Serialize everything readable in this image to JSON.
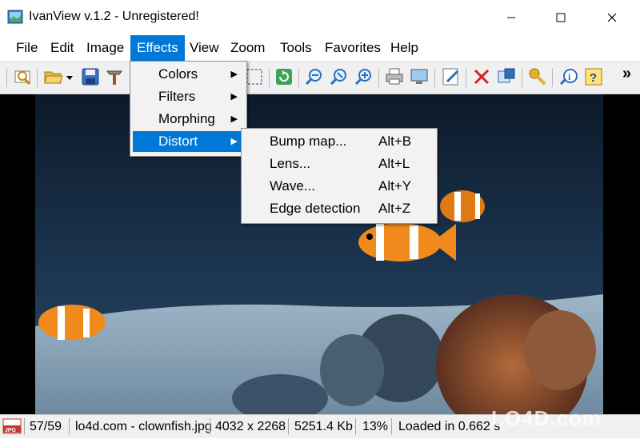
{
  "window": {
    "title": "IvanView v.1.2 - Unregistered!",
    "icons": {
      "app": "app-icon",
      "minimize": "minimize-icon",
      "maximize": "maximize-icon",
      "close": "close-icon"
    }
  },
  "menubar": {
    "items": [
      {
        "label": "File"
      },
      {
        "label": "Edit"
      },
      {
        "label": "Image"
      },
      {
        "label": "Effects",
        "active": true
      },
      {
        "label": "View"
      },
      {
        "label": "Zoom"
      },
      {
        "label": "Tools"
      },
      {
        "label": "Favorites"
      },
      {
        "label": "Help"
      }
    ]
  },
  "toolbar": {
    "icons": [
      "browse-icon",
      "open-folder-icon",
      "dropdown-arrow-icon",
      "save-icon",
      "tools-icon",
      "select-icon",
      "refresh-icon",
      "zoom-out-icon",
      "zoom-fit-icon",
      "zoom-in-icon",
      "print-icon",
      "screen-icon",
      "edit-icon",
      "delete-icon",
      "properties-icon",
      "key-icon",
      "info-icon",
      "help-icon",
      "overflow-chevron-icon"
    ],
    "overflow_label": "»"
  },
  "effects_menu": {
    "items": [
      {
        "label": "Colors",
        "has_submenu": true
      },
      {
        "label": "Filters",
        "has_submenu": true
      },
      {
        "label": "Morphing",
        "has_submenu": true
      },
      {
        "label": "Distort",
        "has_submenu": true,
        "highlighted": true
      }
    ],
    "arrow": "▶"
  },
  "distort_menu": {
    "items": [
      {
        "label": "Bump map...",
        "shortcut": "Alt+B"
      },
      {
        "label": "Lens...",
        "shortcut": "Alt+L"
      },
      {
        "label": "Wave...",
        "shortcut": "Alt+Y"
      },
      {
        "label": "Edge detection",
        "shortcut": "Alt+Z"
      }
    ]
  },
  "statusbar": {
    "format_badge": "JPG",
    "position": "57/59",
    "filename": "lo4d.com - clownfish.jpg",
    "dimensions": "4032 x 2268",
    "filesize": "5251.4 Kb",
    "zoom": "13%",
    "load_time": "Loaded in 0.662 s"
  },
  "watermark": "LO4D.com",
  "colors": {
    "accent": "#0078d7",
    "menu_bg": "#f2f2f2",
    "toolbar_bg": "#f0f0f0"
  }
}
